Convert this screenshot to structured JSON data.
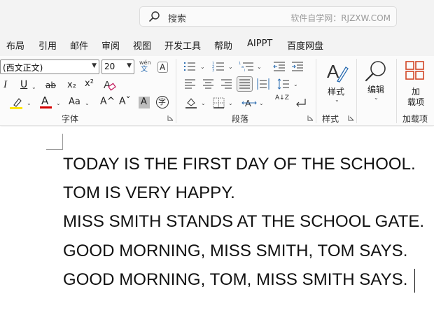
{
  "search": {
    "placeholder": "搜索",
    "watermark": "软件自学网：RJZXW.COM"
  },
  "menu": [
    "布局",
    "引用",
    "邮件",
    "审阅",
    "视图",
    "开发工具",
    "帮助",
    "AIPPT",
    "百度网盘"
  ],
  "font_group": {
    "font_name": "(西文正文)",
    "font_size": "20",
    "phonetic_top": "wén",
    "phonetic_bottom": "文",
    "char_border": "A",
    "italic": "I",
    "underline": "U",
    "strike": "ab",
    "subscript": "x₂",
    "superscript": "x²",
    "case": "Aa",
    "grow": "A^",
    "shrink": "Aˇ",
    "shade": "A",
    "enclose": "字",
    "label": "字体",
    "highlight_color": "#ffe600",
    "font_color": "#d40000"
  },
  "paragraph_group": {
    "sort": "A↓Z",
    "label": "段落"
  },
  "styles_group": {
    "button_label": "样式",
    "label": "样式"
  },
  "editing_group": {
    "button_label": "编辑"
  },
  "addins_group": {
    "button_label_line1": "加",
    "button_label_line2": "载项",
    "label": "加载项",
    "accent": "#d24726"
  },
  "document": {
    "lines": [
      "TODAY IS THE FIRST DAY OF THE SCHOOL.",
      "TOM IS VERY HAPPY.",
      "MISS SMITH STANDS AT THE SCHOOL GATE.",
      "GOOD MORNING, MISS SMITH, TOM SAYS.",
      "GOOD MORNING, TOM, MISS SMITH SAYS."
    ]
  }
}
